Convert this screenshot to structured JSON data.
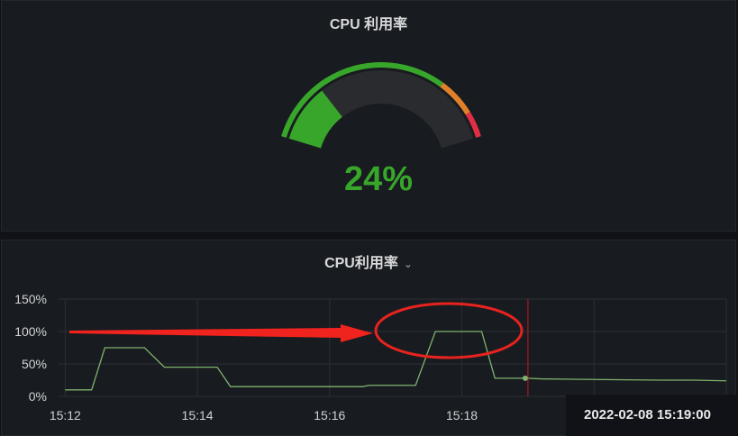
{
  "gauge_panel": {
    "title": "CPU 利用率",
    "value_text": "24%",
    "value": 24,
    "min": 0,
    "max": 100,
    "thresholds": [
      {
        "from": 0,
        "to": 75,
        "color": "#37a62a"
      },
      {
        "from": 75,
        "to": 90,
        "color": "#e0812a"
      },
      {
        "from": 90,
        "to": 100,
        "color": "#e02f44"
      }
    ],
    "value_color": "#37a62a"
  },
  "graph_panel": {
    "title": "CPU利用率",
    "menu_icon": "chevron-down-icon",
    "tooltip_time": "2022-02-08 15:19:00"
  },
  "chart_data": {
    "type": "line",
    "series": [
      {
        "x": [
          "15:12",
          "15:12.4",
          "15:12.6",
          "15:13.2",
          "15:13.5",
          "15:14.3",
          "15:14.5",
          "15:16.5",
          "15:16.6",
          "15:17.3",
          "15:17.6",
          "15:18.3",
          "15:18.5",
          "15:19",
          "15:19.2",
          "15:20",
          "15:21",
          "15:21.5",
          "15:22"
        ],
        "values": [
          10,
          10,
          75,
          75,
          45,
          45,
          15,
          15,
          17,
          17,
          100,
          100,
          28,
          28,
          27,
          26,
          25,
          25,
          24
        ],
        "color": "#7eb26d"
      }
    ],
    "x_ticks": [
      "15:12",
      "15:14",
      "15:16",
      "15:18"
    ],
    "y_ticks": [
      "0%",
      "50%",
      "100%",
      "150%"
    ],
    "ylim": [
      0,
      150
    ],
    "xlim": [
      "15:11.9",
      "15:22"
    ],
    "grid": true,
    "cursor_time": "15:19",
    "annotations": [
      "red-arrow",
      "red-ellipse"
    ]
  }
}
